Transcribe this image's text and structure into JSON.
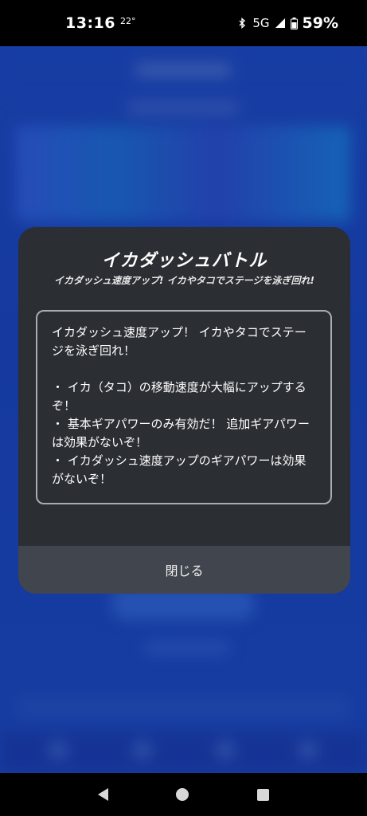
{
  "status_bar": {
    "time": "13:16",
    "temperature": "22°",
    "network": "5G",
    "battery": "59%"
  },
  "dialog": {
    "title": "イカダッシュバトル",
    "subtitle": "イカダッシュ速度アップ! イカやタコでステージを泳ぎ回れ!",
    "description": {
      "intro": "イカダッシュ速度アップ！ イカやタコでステージを泳ぎ回れ！",
      "bullets": [
        "・ イカ（タコ）の移動速度が大幅にアップするぞ！",
        "・ 基本ギアパワーのみ有効だ！ 追加ギアパワーは効果がないぞ！",
        "・ イカダッシュ速度アップのギアパワーは効果がないぞ！"
      ]
    },
    "close_label": "閉じる"
  },
  "colors": {
    "background_blue": "#1c48c4",
    "dialog_bg": "#2b2e33",
    "button_bg": "#41454d"
  },
  "icons": {
    "status": [
      "bluetooth-icon",
      "signal-icon",
      "battery-icon"
    ],
    "nav": [
      "back-icon",
      "home-icon",
      "recents-icon"
    ]
  }
}
